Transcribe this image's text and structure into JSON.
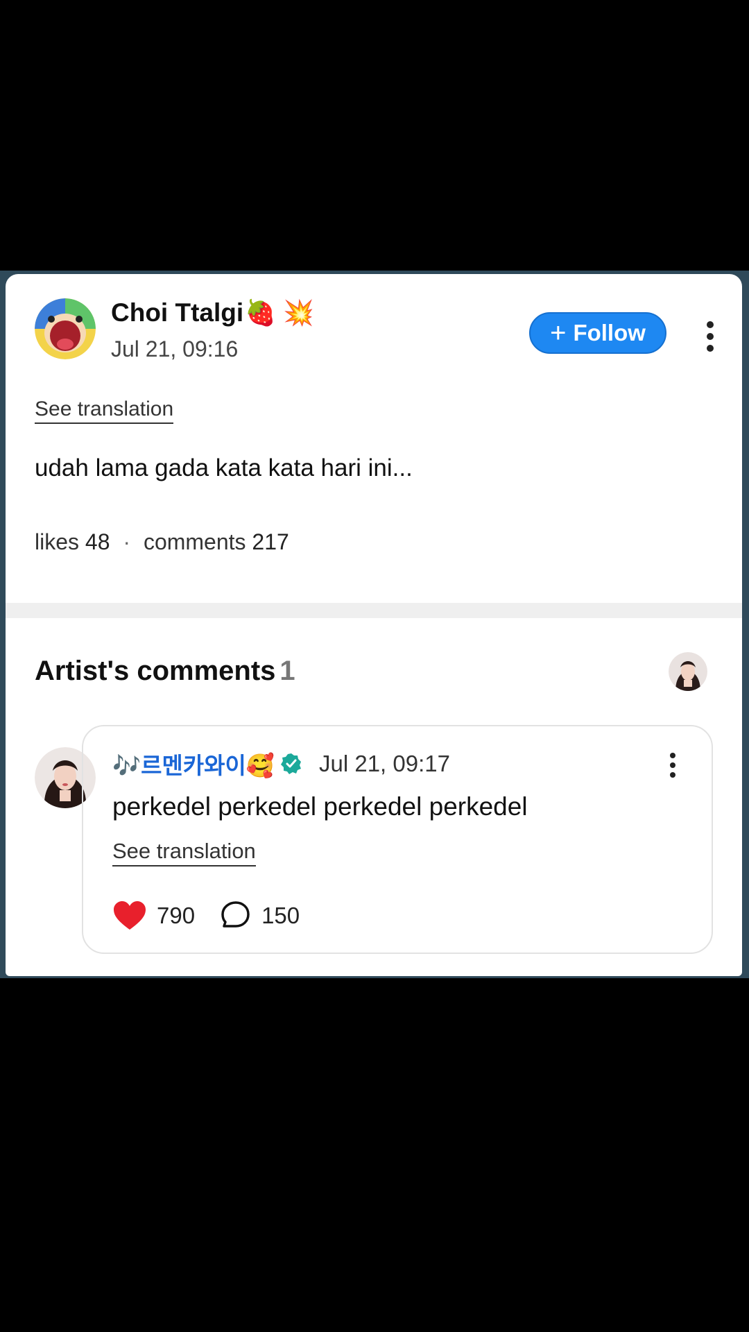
{
  "post": {
    "author_name": "Choi Ttalgi",
    "author_emoji": "🍓 💥",
    "time": "Jul 21, 09:16",
    "follow_label": "Follow",
    "follow_icon": "+",
    "see_translation": "See translation",
    "text": "udah lama gada kata kata hari ini...",
    "likes_label": "likes",
    "likes_count": "48",
    "comments_label": "comments",
    "comments_count": "217"
  },
  "artist_comments": {
    "title": "Artist's comments",
    "count": "1",
    "comment": {
      "name": "🎶르멘카와이🥰",
      "time": "Jul 21, 09:17",
      "text": "perkedel perkedel perkedel perkedel",
      "see_translation": "See translation",
      "likes": "790",
      "replies": "150"
    }
  },
  "colors": {
    "follow_button": "#1e88f2",
    "artist_name": "#1a66d6",
    "heart": "#e8202c",
    "verified": "#1ba99a"
  },
  "icons": [
    "more-vertical-icon",
    "plus-icon",
    "verified-badge-icon",
    "heart-icon",
    "comment-bubble-icon"
  ]
}
